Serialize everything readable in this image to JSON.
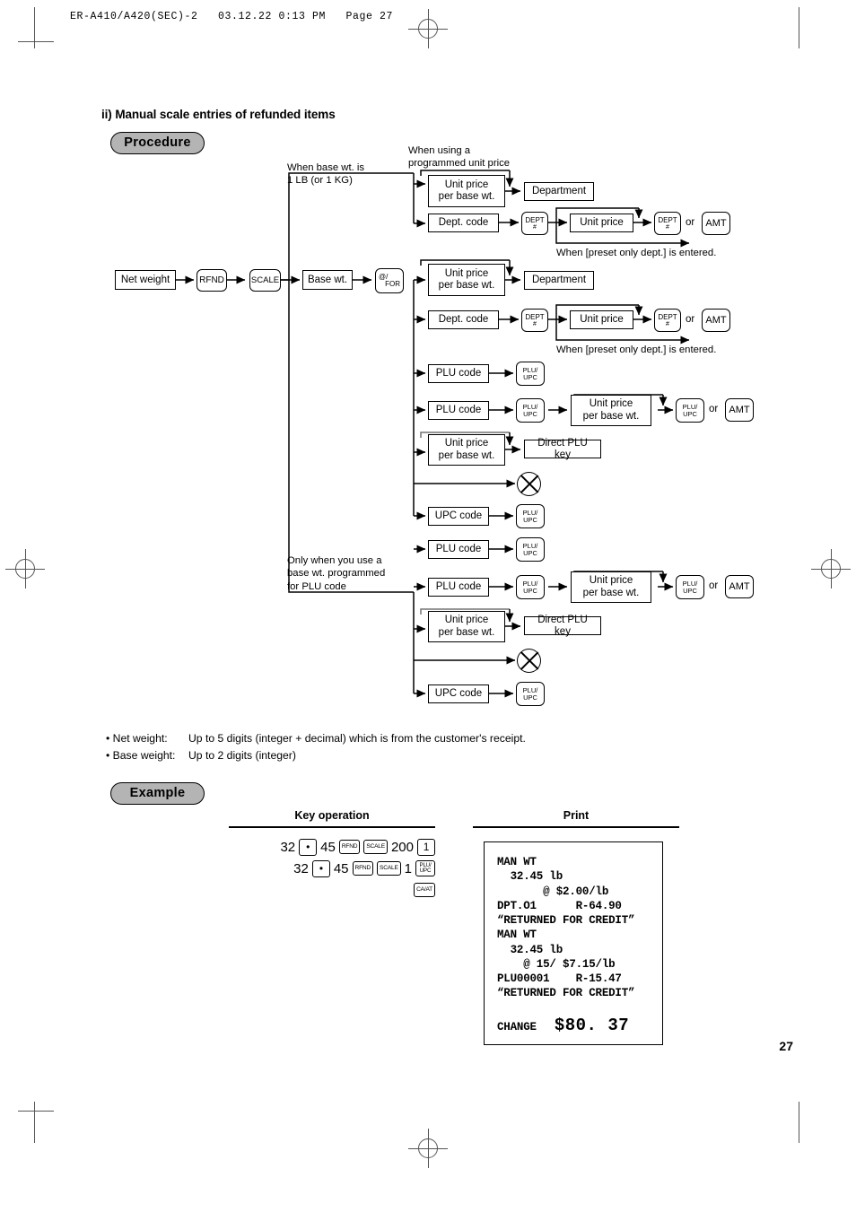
{
  "printer_header": "ER-A410/A420(SEC)-2   03.12.22 0:13 PM   Page 27",
  "section": {
    "title": "ii) Manual scale entries of refunded items",
    "procedure_label": "Procedure",
    "example_label": "Example"
  },
  "flow": {
    "notes": {
      "base_wt_1lb": "When base wt. is\n1 LB (or 1 KG)",
      "programmed_unit_price": "When using a\nprogrammed unit price",
      "preset_only_dept_1": "When [preset only dept.] is entered.",
      "preset_only_dept_2": "When [preset only dept.] is entered.",
      "only_base_wt_plu": "Only when you use a\nbase wt. programmed\nfor PLU code"
    },
    "boxes": {
      "net_weight": "Net weight",
      "base_wt": "Base wt.",
      "unit_price_per_base_wt": "Unit price\nper base wt.",
      "department": "Department",
      "dept_code": "Dept. code",
      "unit_price": "Unit price",
      "plu_code": "PLU code",
      "upc_code": "UPC code",
      "direct_plu_key": "Direct PLU key"
    },
    "keys": {
      "rfnd": "RFND",
      "scale": "SCALE",
      "at_for_top": "@/",
      "at_for_bottom": "FOR",
      "dept_top": "DEPT",
      "dept_bottom": "#",
      "amt": "AMT",
      "plu_top": "PLU/",
      "plu_bottom": "UPC"
    },
    "or_label": "or",
    "scanner_icon": "scanner-symbol"
  },
  "bullets": [
    {
      "label": "• Net weight:",
      "text": "Up to 5 digits (integer + decimal) which is from the customer's receipt."
    },
    {
      "label": "• Base weight:",
      "text": "Up to 2 digits (integer)"
    }
  ],
  "example": {
    "key_operation_header": "Key operation",
    "print_header": "Print",
    "key_lines": [
      [
        {
          "type": "num",
          "text": "32"
        },
        {
          "type": "key",
          "text": "•",
          "style": "dot"
        },
        {
          "type": "num",
          "text": "45"
        },
        {
          "type": "key",
          "text": "RFND"
        },
        {
          "type": "key",
          "text": "SCALE"
        },
        {
          "type": "num",
          "text": "200"
        },
        {
          "type": "key",
          "text": "1",
          "style": "big"
        }
      ],
      [
        {
          "type": "num",
          "text": "32"
        },
        {
          "type": "key",
          "text": "•",
          "style": "dot"
        },
        {
          "type": "num",
          "text": "45"
        },
        {
          "type": "key",
          "text": "RFND"
        },
        {
          "type": "key",
          "text": "SCALE"
        },
        {
          "type": "num",
          "text": "1"
        },
        {
          "type": "key2",
          "top": "PLU/",
          "bottom": "UPC"
        }
      ],
      [
        {
          "type": "key",
          "text": "CA/AT"
        }
      ]
    ]
  },
  "receipt": {
    "lines": [
      "MAN WT",
      "  32.45 lb",
      "       @ $2.00/lb",
      "DPT.O1      R-64.90",
      "“RETURNED FOR CREDIT”",
      "MAN WT",
      "  32.45 lb",
      "    @ 15/ $7.15/lb",
      "PLU00001    R-15.47",
      "“RETURNED FOR CREDIT”"
    ],
    "change_label": "CHANGE",
    "change_amount": "$80. 37"
  },
  "page_number": "27"
}
